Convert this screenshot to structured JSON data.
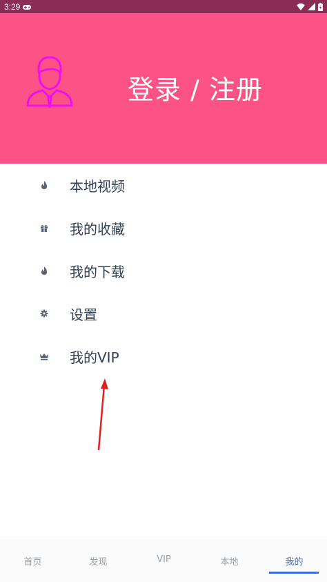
{
  "status": {
    "time": "3:29"
  },
  "header": {
    "title": "登录 / 注册"
  },
  "menu": {
    "items": [
      {
        "label": "本地视频",
        "icon": "flame-icon"
      },
      {
        "label": "我的收藏",
        "icon": "gift-icon"
      },
      {
        "label": "我的下载",
        "icon": "flame-icon"
      },
      {
        "label": "设置",
        "icon": "gear-icon"
      },
      {
        "label": "我的VIP",
        "icon": "crown-icon"
      }
    ]
  },
  "tabbar": {
    "tabs": [
      {
        "label": "首页"
      },
      {
        "label": "发现"
      },
      {
        "label": "VIP"
      },
      {
        "label": "本地"
      },
      {
        "label": "我的"
      }
    ],
    "active": "我的"
  },
  "colors": {
    "header": "#fd5285",
    "statusbar": "#8a2c55",
    "avatar": "#ee11ee",
    "accent": "#3a6fe0",
    "arrow": "#e02020"
  }
}
